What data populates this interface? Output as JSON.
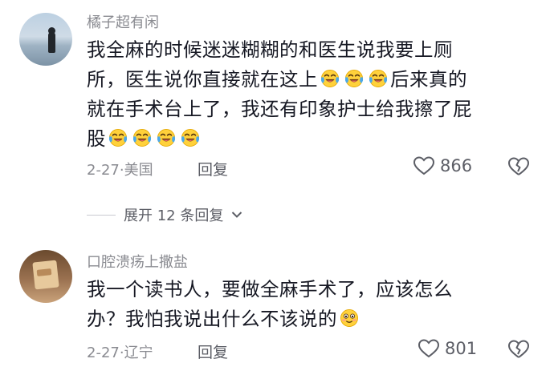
{
  "comments": [
    {
      "username": "橘子超有闲",
      "lines": [
        "我全麻的时候迷迷糊糊的和医生说我要上厕",
        "所，医生说你直接就在这上",
        "后来真的",
        "就在手术台上了，我还有印象护士给我擦了屁",
        "股"
      ],
      "date": "2-27",
      "location": "美国",
      "reply_label": "回复",
      "likes": "866"
    },
    {
      "username": "口腔溃疡上撒盐",
      "lines": [
        "我一个读书人，要做全麻手术了，应该怎么",
        "办？我怕我说出什么不该说的"
      ],
      "date": "2-27",
      "location": "辽宁",
      "reply_label": "回复",
      "likes": "801"
    }
  ],
  "expand_replies": "展开 12 条回复",
  "separator": "·",
  "icons": {
    "laugh_cry": "tears-of-joy-emoji",
    "smile": "blushing-smile-emoji",
    "like": "heart-outline-icon",
    "dislike": "broken-heart-icon",
    "expand": "chevron-down-icon"
  },
  "colors": {
    "text": "#161823",
    "muted": "#8a8b91",
    "emoji_yellow": "#ffd13b",
    "tear_blue": "#4aa8ea"
  }
}
